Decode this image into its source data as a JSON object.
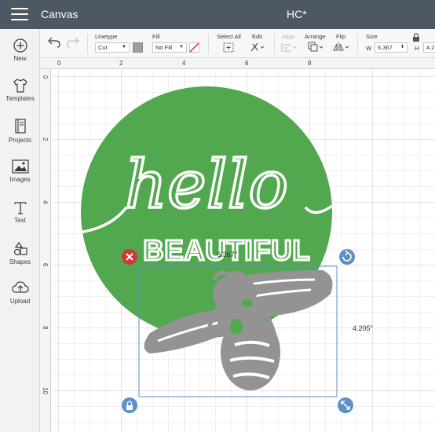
{
  "topbar": {
    "app_title": "Canvas",
    "doc_title": "HC*"
  },
  "sidebar": {
    "items": [
      {
        "label": "New",
        "icon": "plus-circle-icon"
      },
      {
        "label": "Templates",
        "icon": "shirt-icon"
      },
      {
        "label": "Projects",
        "icon": "book-icon"
      },
      {
        "label": "Images",
        "icon": "image-icon"
      },
      {
        "label": "Text",
        "icon": "text-t-icon"
      },
      {
        "label": "Shapes",
        "icon": "shapes-icon"
      },
      {
        "label": "Upload",
        "icon": "cloud-upload-icon"
      }
    ]
  },
  "toolbar": {
    "linetype_label": "Linetype",
    "linetype_value": "Cut",
    "fill_label": "Fill",
    "fill_value": "No Fill",
    "select_all_label": "Select All",
    "edit_label": "Edit",
    "align_label": "Align",
    "arrange_label": "Arrange",
    "flip_label": "Flip",
    "size_label": "Size",
    "width_label": "W",
    "width_value": "6.367",
    "height_label": "H",
    "height_value": "4.2",
    "swatch_color": "#9e9e9e"
  },
  "rulers": {
    "top": [
      "0",
      "2",
      "4",
      "6",
      "8"
    ],
    "left": [
      "0",
      "2",
      "4",
      "6",
      "8",
      "10"
    ]
  },
  "design": {
    "text_hello": "hello",
    "text_beautiful": "BEAUTIFUL",
    "circle_color": "#52a84e",
    "bee_color": "#939393"
  },
  "selection": {
    "width_readout": "6.367\"",
    "height_readout": "4.205\"",
    "delete_color": "#cc3a3a",
    "handle_color": "#5e8fc7"
  }
}
